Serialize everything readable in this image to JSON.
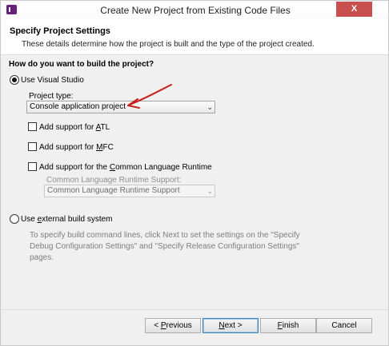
{
  "window": {
    "title": "Create New Project from Existing Code Files",
    "close_glyph": "X"
  },
  "header": {
    "title": "Specify Project Settings",
    "subtitle": "These details determine how the project is built and the type of the project created."
  },
  "build": {
    "question": "How do you want to build the project?",
    "use_vs_label": "Use Visual Studio",
    "project_type_label": "Project type:",
    "project_type_value": "Console application project",
    "atl_prefix": "Add support for ",
    "atl_key": "A",
    "atl_rest": "TL",
    "mfc_prefix": "Add support for ",
    "mfc_key": "M",
    "mfc_rest": "FC",
    "clr_prefix": "Add support for the ",
    "clr_key": "C",
    "clr_rest": "ommon Language Runtime",
    "clr_support_label": "Common Language Runtime Support:",
    "clr_support_value": "Common Language Runtime Support",
    "external_prefix": "Use ",
    "external_key": "e",
    "external_rest": "xternal build system",
    "external_help": "To specify build command lines, click Next to set the settings on the \"Specify Debug Configuration Settings\" and \"Specify Release Configuration Settings\" pages.",
    "use_vs_selected": true,
    "external_selected": false
  },
  "footer": {
    "previous_prefix": "< ",
    "previous_key": "P",
    "previous_rest": "revious",
    "next_key": "N",
    "next_rest": "ext >",
    "finish_key": "F",
    "finish_rest": "inish",
    "cancel_label": "Cancel"
  },
  "colors": {
    "close_button": "#c7504f",
    "annotation_arrow": "#c8201c",
    "default_button_border": "#3c7fb1"
  },
  "icons": {
    "app": "visual-studio-icon",
    "close": "close-icon",
    "dropdown": "chevron-down-icon",
    "annotation": "hand-drawn-arrow"
  }
}
